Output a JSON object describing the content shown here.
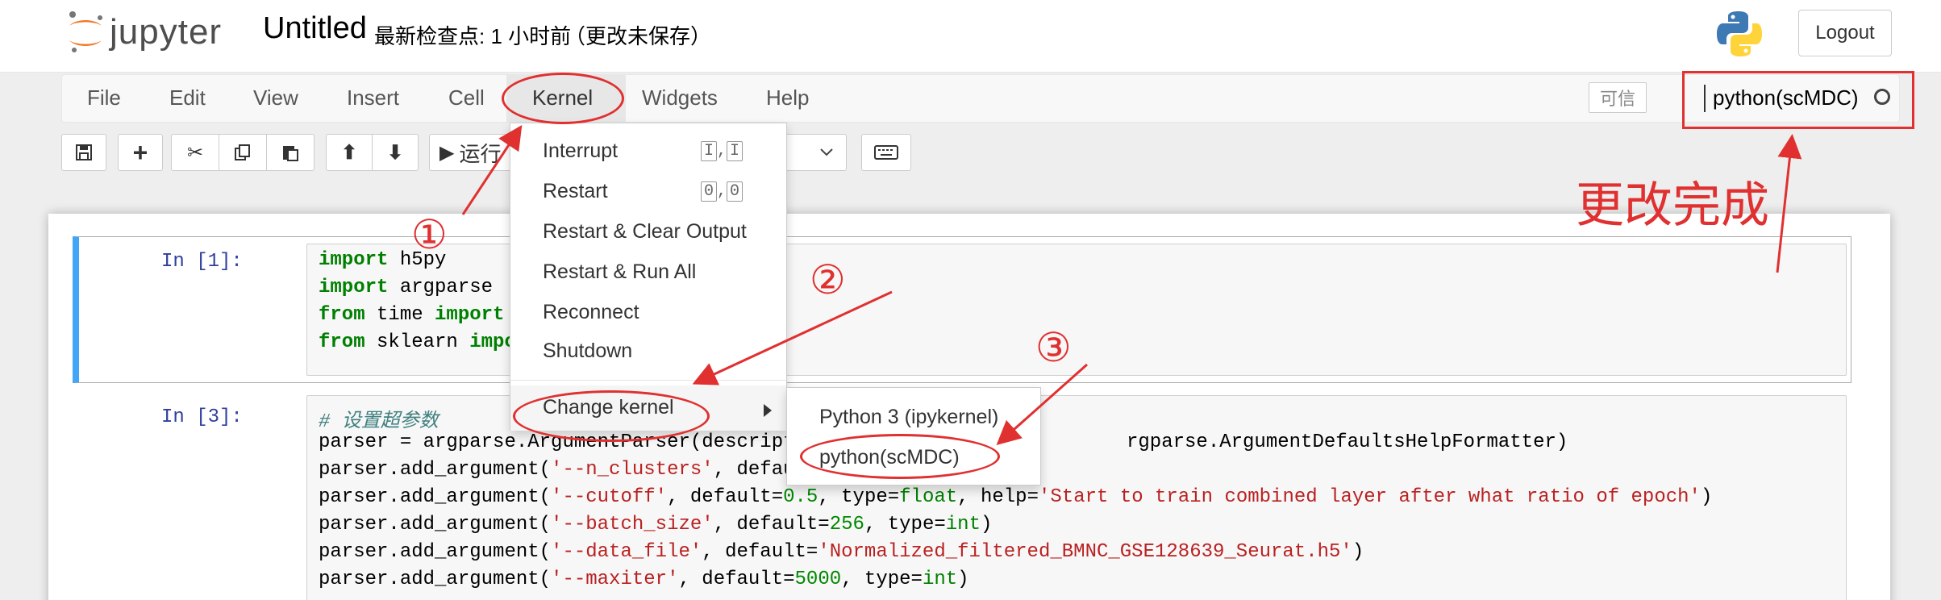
{
  "header": {
    "logo_text": "jupyter",
    "notebook_name": "Untitled",
    "checkpoint": "最新检查点: 1 小时前",
    "autosave": "（更改未保存）",
    "logout_label": "Logout"
  },
  "menubar": {
    "items": [
      "File",
      "Edit",
      "View",
      "Insert",
      "Cell",
      "Kernel",
      "Widgets",
      "Help"
    ],
    "trusted_label": "可信",
    "kernel_name": "python(scMDC)"
  },
  "toolbar": {
    "run_label": "运行"
  },
  "kernel_menu": {
    "items": [
      "Interrupt",
      "Restart",
      "Restart & Clear Output",
      "Restart & Run All",
      "Reconnect",
      "Shutdown"
    ],
    "interrupt_keys": [
      "I",
      "I"
    ],
    "restart_keys": [
      "0",
      "0"
    ],
    "change_kernel": "Change kernel",
    "submenu": [
      "Python 3 (ipykernel)",
      "python(scMDC)"
    ]
  },
  "cells": [
    {
      "prompt": "In  [1]:",
      "lines": [
        "import h5py",
        "import argparse",
        "from time import time",
        "from sklearn import metr"
      ]
    },
    {
      "prompt": "In  [3]:",
      "lines": [
        "# 设置超参数",
        "parser = argparse.ArgumentParser(description='tr",
        "rgparse.ArgumentDefaultsHelpFormatter)",
        "parser.add_argument('--n_clusters', default=27, ",
        "parser.add_argument('--cutoff', default=0.5, type=float, help='Start to train combined layer after what ratio of epoch')",
        "parser.add_argument('--batch_size', default=256, type=int)",
        "parser.add_argument('--data_file', default='Normalized_filtered_BMNC_GSE128639_Seurat.h5')",
        "parser.add_argument('--maxiter', default=5000, type=int)"
      ]
    }
  ],
  "annotations": {
    "step1": "①",
    "step2": "②",
    "step3": "③",
    "done": "更改完成"
  },
  "colors": {
    "annotation": "#e03030",
    "cell_selected": "#42a5f5",
    "prompt": "#303f9f",
    "keyword": "#008000",
    "string": "#ba2121"
  }
}
